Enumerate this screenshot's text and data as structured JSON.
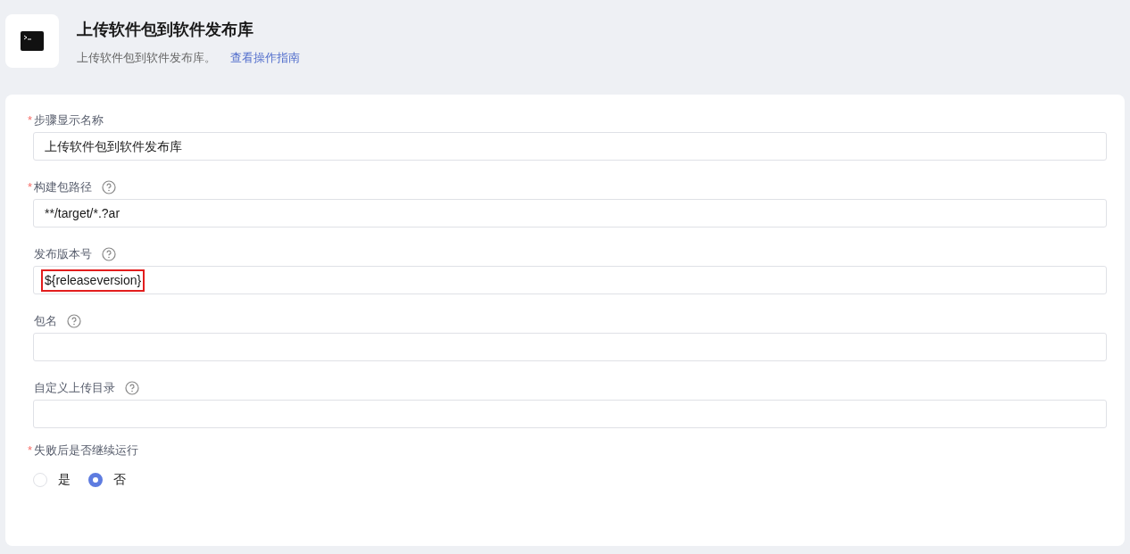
{
  "header": {
    "title": "上传软件包到软件发布库",
    "description": "上传软件包到软件发布库。",
    "guide_link": "查看操作指南"
  },
  "fields": [
    {
      "required_mark": "*",
      "label": "步骤显示名称",
      "value": "上传软件包到软件发布库"
    },
    {
      "required_mark": "*",
      "label": "构建包路径",
      "help": true,
      "value": "**/target/*.?ar"
    },
    {
      "label": "发布版本号",
      "help": true,
      "value": "${releaseversion}",
      "highlighted": true
    },
    {
      "label": "包名",
      "help": true
    },
    {
      "label": "自定义上传目录",
      "help": true
    }
  ],
  "continue_on_failure": {
    "required_mark": "*",
    "label": "失败后是否继续运行",
    "options": [
      {
        "label": "是",
        "selected": false
      },
      {
        "label": "否",
        "selected": true
      }
    ]
  }
}
